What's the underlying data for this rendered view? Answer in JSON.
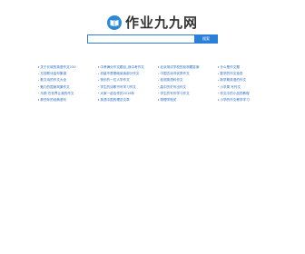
{
  "site": {
    "title": "作业九九网",
    "logo_icon": "book-icon",
    "accent": "#2b7fd8",
    "link_color": "#2b6cc4"
  },
  "search": {
    "placeholder": "",
    "value": "",
    "button_label": "搜索"
  },
  "links": {
    "col1": [
      "关于长城的英语作文150",
      "五桂联诗金句集锦",
      "散文诗的作文大全",
      "魅力的国家风景作文",
      "乐颜 在世界让我的作文",
      "那些年的经典语句"
    ],
    "col2": [
      "中考满分作文题目_我中考作文",
      "初级不是基础阅读部分作文",
      "快乐的一位人学作文",
      "学生的诗歌书写学习作文",
      "大家一起合作的2016年",
      "英语中国的理念文章"
    ],
    "col3": [
      "北京测试学校的检测题答案",
      "中国古诗词优秀作文",
      "检测英语科作文",
      "高中历史写出作文",
      "学生的写作学习作文",
      "物理学相关"
    ],
    "col4": [
      "什么是作文题",
      "数学的作文检查",
      "新学期英语的作文",
      "小学周 写作文",
      "作文中的小品的教程",
      "小学的作文教学学习"
    ]
  }
}
